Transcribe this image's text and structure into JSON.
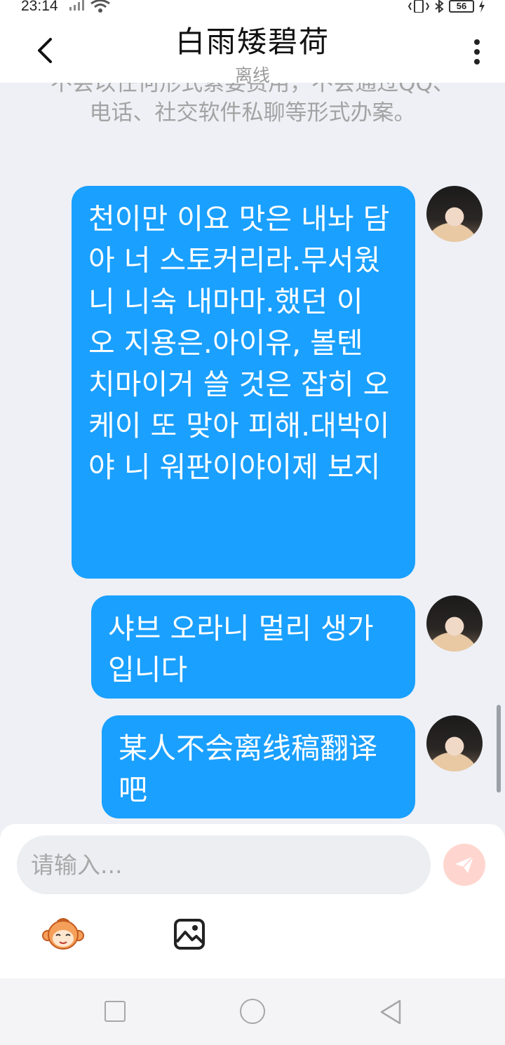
{
  "status_bar": {
    "time": "23:14",
    "battery": "56"
  },
  "header": {
    "title": "白雨矮碧荷",
    "subtitle": "离线"
  },
  "chat": {
    "system_notice": "不会以任何形式索要费用，不会通过QQ、电话、社交软件私聊等形式办案。",
    "messages": [
      {
        "sender": "me",
        "text": "천이만 이요 맛은 내놔 담아 너 스토커리라.무서웠니 니숙 내마마.했던 이 오 지용은.아이유, 볼텐 치마이거 쓸 것은 잡히 오케이 또 맞아 피해.대박이야 니 워판이야이제 보지"
      },
      {
        "sender": "me",
        "text": "샤브 오라니 멀리 생가입니다"
      },
      {
        "sender": "me",
        "text": "某人不会离线稿翻译吧"
      }
    ]
  },
  "composer": {
    "placeholder": "请输入..."
  },
  "colors": {
    "bubble": "#1aa0ff",
    "send_button": "#ffd6cf",
    "background": "#eef0f5"
  }
}
